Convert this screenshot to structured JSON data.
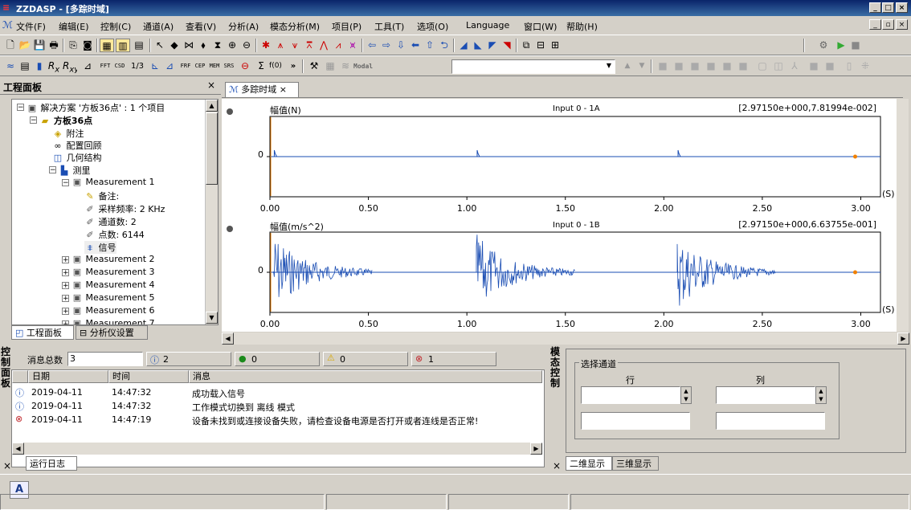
{
  "window": {
    "title": "ZZDASP - [多踪时域]",
    "min": "_",
    "max": "□",
    "close": "×"
  },
  "menu": [
    "文件(F)",
    "编辑(E)",
    "控制(C)",
    "通道(A)",
    "查看(V)",
    "分析(A)",
    "模态分析(M)",
    "项目(P)",
    "工具(T)",
    "选项(O)",
    "Language",
    "窗口(W)",
    "帮助(H)"
  ],
  "toolbar2": {
    "modal_label": "Modal",
    "text_icons": [
      "FFT",
      "CSD",
      "1/3",
      "FRF",
      "CEP",
      "MEM",
      "SRS",
      "Σ",
      "f(0)"
    ]
  },
  "left_panel": {
    "title": "工程面板",
    "tree": [
      {
        "label": "解决方案 '方板36点' : 1 个项目",
        "icon": "solution-icon"
      },
      {
        "label": "方板36点",
        "icon": "project-folder-icon",
        "bold": true
      },
      {
        "label": "附注",
        "icon": "note-icon"
      },
      {
        "label": "配置回顾",
        "icon": "glasses-icon"
      },
      {
        "label": "几何结构",
        "icon": "cube-icon"
      },
      {
        "label": "测里",
        "icon": "measure-icon"
      },
      {
        "label": "Measurement 1",
        "icon": "monitor-icon"
      },
      {
        "label": "备注:",
        "icon": "pencil-icon"
      },
      {
        "label": "采样频率: 2 KHz",
        "icon": "wrench-icon"
      },
      {
        "label": "通道数: 2",
        "icon": "wrench-icon"
      },
      {
        "label": "点数: 6144",
        "icon": "wrench-icon"
      },
      {
        "label": "信号",
        "icon": "signal-icon"
      },
      {
        "label": "Measurement 2",
        "icon": "monitor-icon"
      },
      {
        "label": "Measurement 3",
        "icon": "monitor-icon"
      },
      {
        "label": "Measurement 4",
        "icon": "monitor-icon"
      },
      {
        "label": "Measurement 5",
        "icon": "monitor-icon"
      },
      {
        "label": "Measurement 6",
        "icon": "monitor-icon"
      },
      {
        "label": "Measurement 7",
        "icon": "monitor-icon"
      }
    ],
    "tabs": [
      "工程面板",
      "分析仪设置"
    ]
  },
  "doc_tab": {
    "label": "多踪时域",
    "close": "×"
  },
  "charts": [
    {
      "ylabel": "幅值(N)",
      "channel": "Input 0 - 1A",
      "cursor": "[2.97150e+000,7.81994e-002]",
      "ytick": "0",
      "xunit": "(S)",
      "xticks": [
        "0.00",
        "0.50",
        "1.00",
        "1.50",
        "2.00",
        "2.50",
        "3.00"
      ],
      "impulses": [
        0.01,
        1.04,
        2.06
      ],
      "type": "impulse"
    },
    {
      "ylabel": "幅值(m/s^2)",
      "channel": "Input 0 - 1B",
      "cursor": "[2.97150e+000,6.63755e-001]",
      "ytick": "0",
      "xunit": "(S)",
      "xticks": [
        "0.00",
        "0.50",
        "1.00",
        "1.50",
        "2.00",
        "2.50",
        "3.00"
      ],
      "impulses": [
        0.01,
        1.04,
        2.06
      ],
      "type": "decay"
    }
  ],
  "chart_data": [
    {
      "type": "line",
      "title": "",
      "ylabel": "幅值(N)",
      "xlabel": "(S)",
      "xlim": [
        0,
        3.1
      ],
      "series": [
        {
          "name": "Input 0 - 1A"
        }
      ],
      "x_impulses": [
        0.01,
        1.04,
        2.06
      ]
    },
    {
      "type": "line",
      "title": "",
      "ylabel": "幅值(m/s^2)",
      "xlabel": "(S)",
      "xlim": [
        0,
        3.1
      ],
      "series": [
        {
          "name": "Input 0 - 1B"
        }
      ],
      "x_impulses": [
        0.01,
        1.04,
        2.06
      ]
    }
  ],
  "control_panel": {
    "title": "控制面板",
    "title_chars": [
      "控",
      "制",
      "面",
      "板"
    ]
  },
  "messages": {
    "total_label": "消息总数",
    "total_value": "3",
    "info_count": "2",
    "ok_count": "0",
    "warn_count": "0",
    "error_count": "1",
    "columns": [
      "日期",
      "时间",
      "消息"
    ],
    "rows": [
      {
        "type": "info",
        "date": "2019-04-11",
        "time": "14:47:32",
        "msg": "成功载入信号"
      },
      {
        "type": "info",
        "date": "2019-04-11",
        "time": "14:47:32",
        "msg": "工作模式切换到 离线 模式"
      },
      {
        "type": "error",
        "date": "2019-04-11",
        "time": "14:47:19",
        "msg": "设备未找到或连接设备失败，请检查设备电源是否打开或者连线是否正常!"
      }
    ],
    "tab": "运行日志"
  },
  "modal_panel": {
    "title_chars": [
      "模",
      "态",
      "控",
      "制"
    ],
    "group": "选择通道",
    "row_label": "行",
    "col_label": "列",
    "tabs": [
      "二维显示",
      "三维显示"
    ]
  },
  "status": {
    "letter": "A"
  }
}
